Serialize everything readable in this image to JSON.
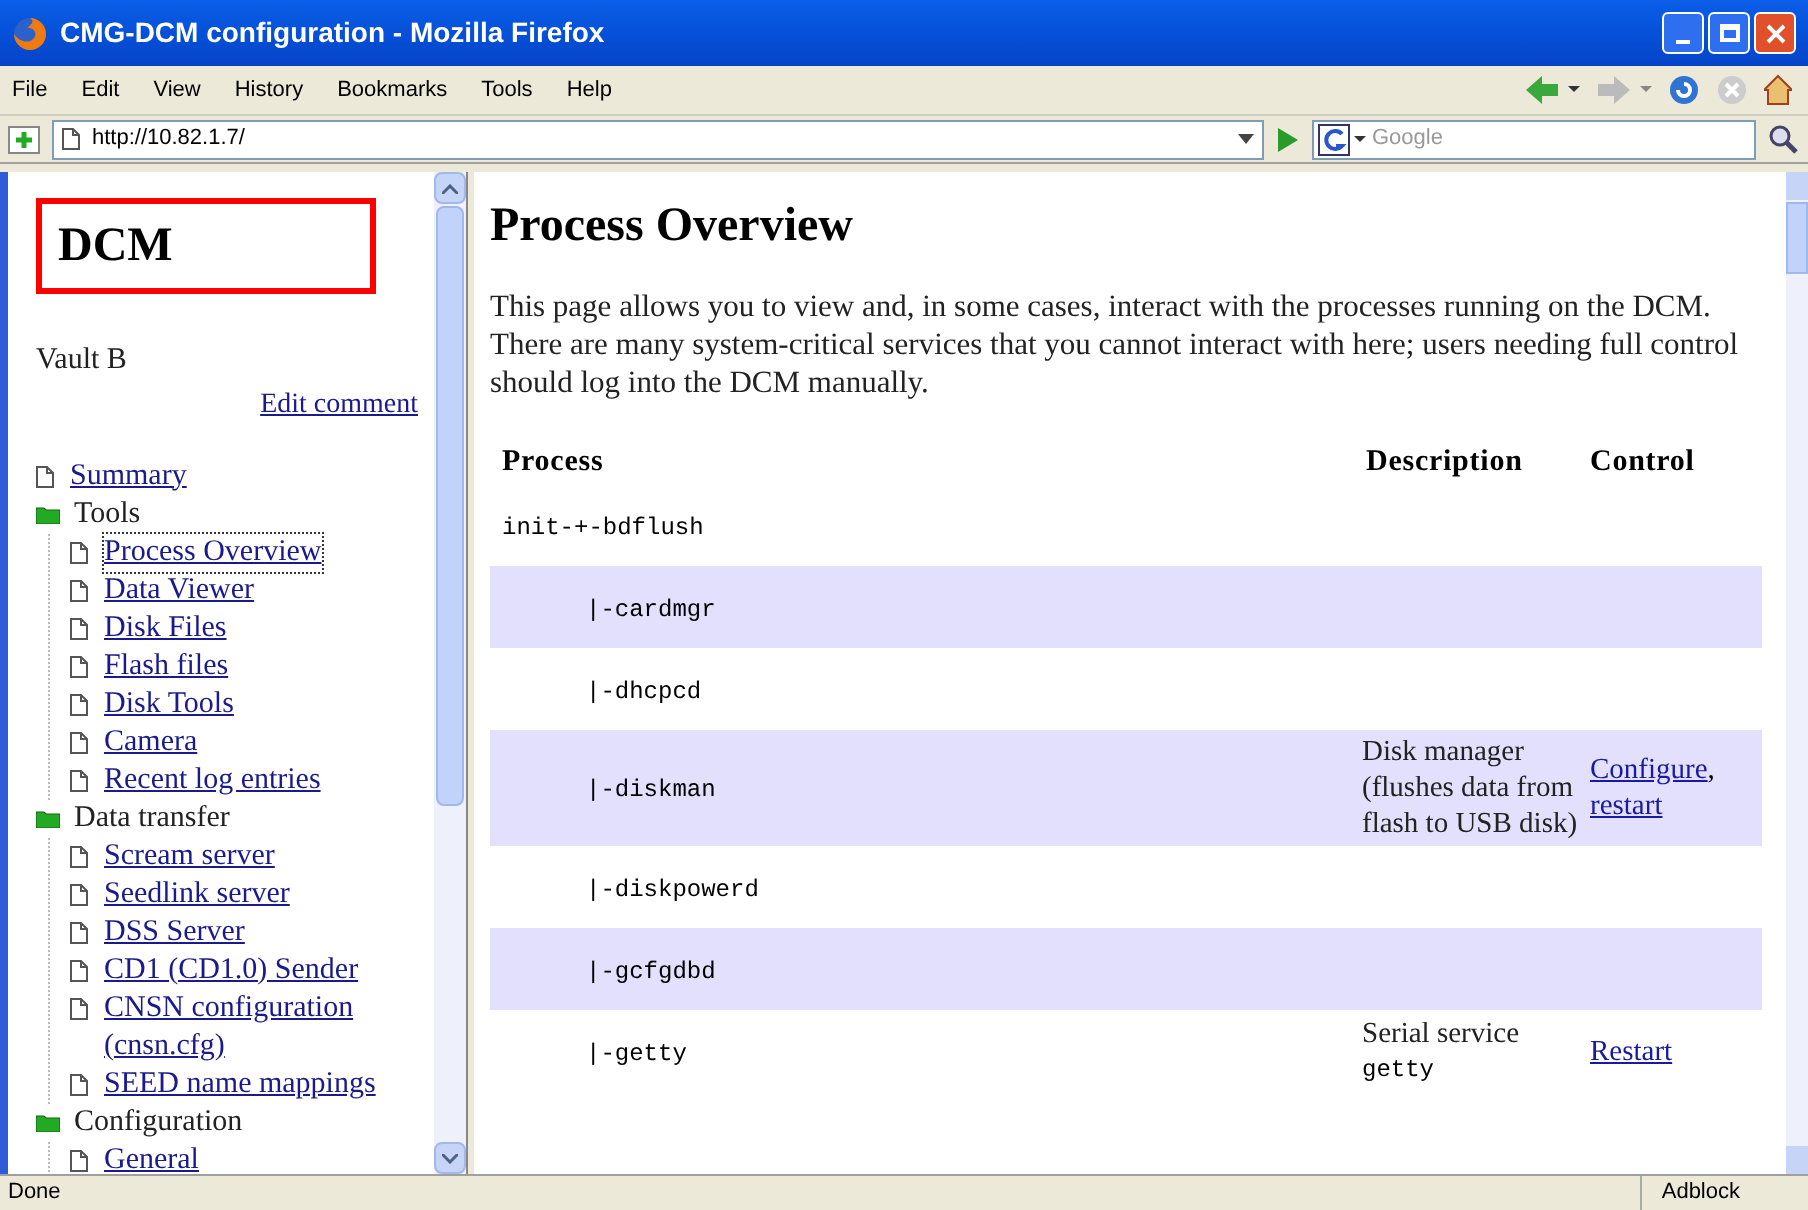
{
  "window": {
    "title": "CMG-DCM configuration - Mozilla Firefox"
  },
  "menu": [
    "File",
    "Edit",
    "View",
    "History",
    "Bookmarks",
    "Tools",
    "Help"
  ],
  "address": {
    "value": "http://10.82.1.7/"
  },
  "search": {
    "placeholder": "Google"
  },
  "sidebar": {
    "heading": "DCM",
    "comment": "Vault B",
    "edit_link": "Edit comment",
    "tree": [
      {
        "kind": "page",
        "label": "Summary",
        "selected": false
      },
      {
        "kind": "folder",
        "label": "Tools",
        "children": [
          {
            "kind": "page",
            "label": "Process Overview",
            "selected": true
          },
          {
            "kind": "page",
            "label": "Data Viewer",
            "selected": false
          },
          {
            "kind": "page",
            "label": "Disk Files",
            "selected": false
          },
          {
            "kind": "page",
            "label": "Flash files",
            "selected": false
          },
          {
            "kind": "page",
            "label": "Disk Tools",
            "selected": false
          },
          {
            "kind": "page",
            "label": "Camera",
            "selected": false
          },
          {
            "kind": "page",
            "label": "Recent log entries",
            "selected": false
          }
        ]
      },
      {
        "kind": "folder",
        "label": "Data transfer",
        "children": [
          {
            "kind": "page",
            "label": "Scream server",
            "selected": false
          },
          {
            "kind": "page",
            "label": "Seedlink server",
            "selected": false
          },
          {
            "kind": "page",
            "label": "DSS Server",
            "selected": false
          },
          {
            "kind": "page",
            "label": "CD1 (CD1.0) Sender",
            "selected": false
          },
          {
            "kind": "page",
            "label": "CNSN configuration (cnsn.cfg)",
            "selected": false
          },
          {
            "kind": "page",
            "label": "SEED name mappings",
            "selected": false
          }
        ]
      },
      {
        "kind": "folder",
        "label": "Configuration",
        "children": [
          {
            "kind": "page",
            "label": "General",
            "selected": false
          }
        ]
      }
    ]
  },
  "main": {
    "title": "Process Overview",
    "intro": "This page allows you to view and, in some cases, interact with the processes running on the DCM. There are many system-critical services that you cannot interact with here; users needing full control should log into the DCM manually.",
    "table": {
      "columns": [
        "Process",
        "Description",
        "Control"
      ],
      "rows": [
        {
          "process": "init-+-bdflush"
        },
        {
          "process": "|-cardmgr"
        },
        {
          "process": "|-dhcpcd"
        },
        {
          "process": "|-diskman",
          "description": "Disk manager (flushes data from flash to USB disk)",
          "controls": [
            {
              "label": "Configure",
              "suffix": ","
            },
            {
              "label": "restart"
            }
          ]
        },
        {
          "process": "|-diskpowerd"
        },
        {
          "process": "|-gcfgdbd"
        },
        {
          "process": "|-getty",
          "description": "Serial service",
          "description_code": "getty",
          "controls": [
            {
              "label": "Restart"
            }
          ]
        }
      ]
    }
  },
  "status_bar": {
    "text": "Done",
    "addon": "Adblock"
  }
}
